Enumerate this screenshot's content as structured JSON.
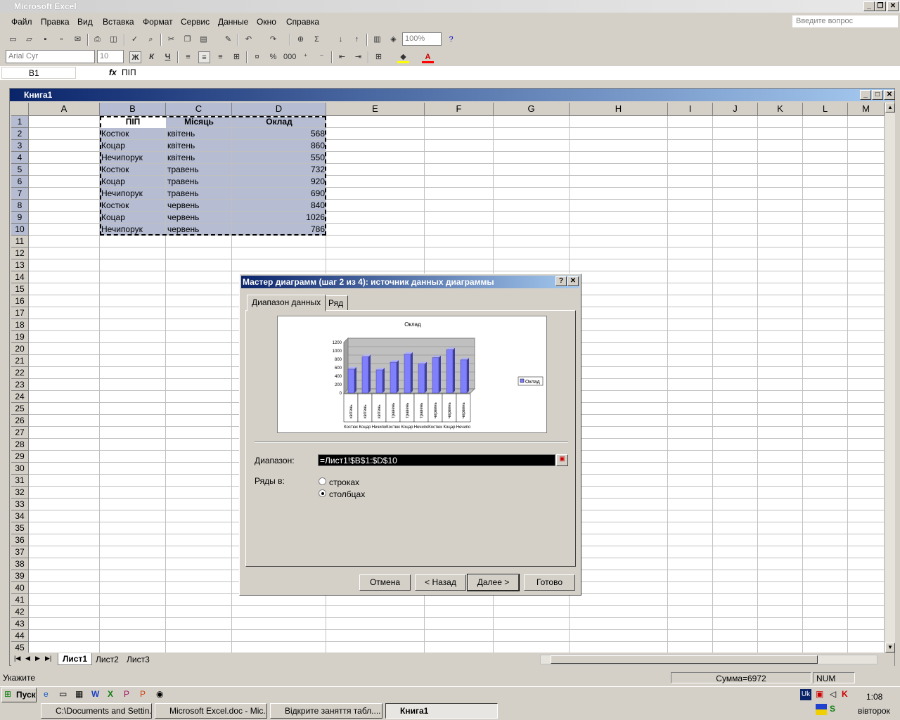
{
  "app": {
    "title": "Microsoft Excel",
    "help_placeholder": "Введите вопрос"
  },
  "menu": [
    "Файл",
    "Правка",
    "Вид",
    "Вставка",
    "Формат",
    "Сервис",
    "Данные",
    "Окно",
    "Справка"
  ],
  "toolbar": {
    "zoom": "100%",
    "font": "Arial Cyr",
    "size": "10",
    "bold": "Ж",
    "italic": "К",
    "underline": "Ч"
  },
  "formula": {
    "cell": "B1",
    "fx": "fx",
    "value": "ПІП"
  },
  "workbook": {
    "title": "Книга1"
  },
  "columns": [
    "A",
    "B",
    "C",
    "D",
    "E",
    "F",
    "G",
    "H",
    "I",
    "J",
    "K",
    "L",
    "M"
  ],
  "rows": [
    "1",
    "2",
    "3",
    "4",
    "5",
    "6",
    "7",
    "8",
    "9",
    "10",
    "11",
    "12",
    "13",
    "14",
    "15",
    "16",
    "17",
    "18",
    "19",
    "20",
    "21",
    "22",
    "23",
    "24",
    "25",
    "26",
    "27",
    "28",
    "29",
    "30",
    "31",
    "32",
    "33",
    "34",
    "35",
    "36",
    "37",
    "38",
    "39",
    "40",
    "41",
    "42",
    "43",
    "44",
    "45"
  ],
  "table": {
    "headers": [
      "ПІП",
      "Місяць",
      "Оклад"
    ],
    "rows": [
      [
        "Костюк",
        "квітень",
        "568"
      ],
      [
        "Коцар",
        "квітень",
        "860"
      ],
      [
        "Нечипорук",
        "квітень",
        "550"
      ],
      [
        "Костюк",
        "травень",
        "732"
      ],
      [
        "Коцар",
        "травень",
        "920"
      ],
      [
        "Нечипорук",
        "травень",
        "690"
      ],
      [
        "Костюк",
        "червень",
        "840"
      ],
      [
        "Коцар",
        "червень",
        "1026"
      ],
      [
        "Нечипорук",
        "червень",
        "786"
      ]
    ]
  },
  "sheets": [
    "Лист1",
    "Лист2",
    "Лист3"
  ],
  "status": {
    "mode": "Укажите",
    "sum": "Сумма=6972",
    "num": "NUM"
  },
  "dialog": {
    "title": "Мастер диаграмм (шаг 2 из 4): источник данных диаграммы",
    "tabs": [
      "Диапазон данных",
      "Ряд"
    ],
    "range_label": "Диапазон:",
    "range_value": "=Лист1!$B$1:$D$10",
    "series_label": "Ряды в:",
    "opt_rows": "строках",
    "opt_cols": "столбцах",
    "buttons": {
      "cancel": "Отмена",
      "back": "< Назад",
      "next": "Далее >",
      "finish": "Готово"
    }
  },
  "chart_data": {
    "type": "bar",
    "title": "Оклад",
    "categories": [
      "квітень Костюк",
      "квітень Коцар",
      "квітень Нечипорук",
      "травень Костюк",
      "травень Коцар",
      "травень Нечипорук",
      "червень Костюк",
      "червень Коцар",
      "червень Нечипорук"
    ],
    "series": [
      {
        "name": "Оклад",
        "values": [
          568,
          860,
          550,
          732,
          920,
          690,
          840,
          1026,
          786
        ]
      }
    ],
    "yticks": [
      "1200",
      "1000",
      "800",
      "600",
      "400",
      "200",
      "0"
    ],
    "ylim": [
      0,
      1200
    ],
    "legend": "right",
    "color": "#8080ff"
  },
  "taskbar": {
    "start": "Пуск",
    "tasks": [
      "C:\\Documents and Settin...",
      "Microsoft Excel.doc - Mic...",
      "Відкрите заняття табл....",
      "Книга1"
    ],
    "time": "1:08",
    "day": "вівторок",
    "lang": "Uk"
  }
}
